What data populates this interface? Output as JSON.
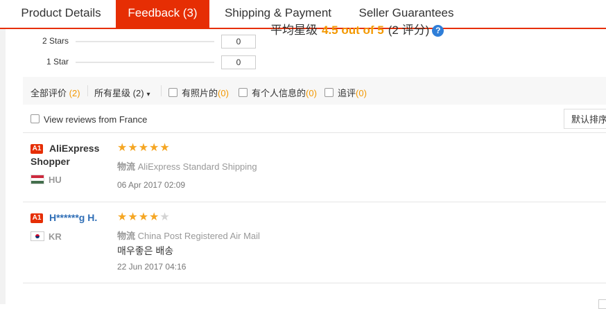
{
  "tabs": [
    {
      "label": "Product Details"
    },
    {
      "label": "Feedback (3)"
    },
    {
      "label": "Shipping & Payment"
    },
    {
      "label": "Seller Guarantees"
    }
  ],
  "summary": {
    "text_before": "平均星级",
    "score": "4.5 out of 5",
    "count_text": "(2 评分)"
  },
  "star_breakdown": [
    {
      "label": "2 Stars",
      "count": "0"
    },
    {
      "label": "1 Star",
      "count": "0"
    }
  ],
  "filters": {
    "all": {
      "label": "全部评价",
      "count": "(2)"
    },
    "ratings": {
      "label": "所有星级",
      "count": "(2)"
    },
    "with_photos": {
      "label": "有照片的",
      "count": "(0)"
    },
    "with_info": {
      "label": "有个人信息的",
      "count": "(0)"
    },
    "additional": {
      "label": "追评",
      "count": "(0)"
    }
  },
  "country_filter": {
    "label": "View reviews from France"
  },
  "sort": {
    "label": "默认排序"
  },
  "reviews": [
    {
      "badge": "A1",
      "name_line1": "AliExpress",
      "name_line2": "Shopper",
      "country": "HU",
      "rating": 5,
      "shipping_label": "物流",
      "shipping": "AliExpress Standard Shipping",
      "comment": "",
      "date": "06 Apr 2017 02:09"
    },
    {
      "badge": "A1",
      "name_line1": "H******g H.",
      "name_line2": "",
      "country": "KR",
      "rating": 4,
      "shipping_label": "物流",
      "shipping": "China Post Registered Air Mail",
      "comment": "매우좋은 배송",
      "date": "22 Jun 2017 04:16"
    }
  ],
  "colors": {
    "accent": "#e62e04",
    "star": "#f5a623",
    "count": "#f39800",
    "link": "#2f6eb6"
  }
}
